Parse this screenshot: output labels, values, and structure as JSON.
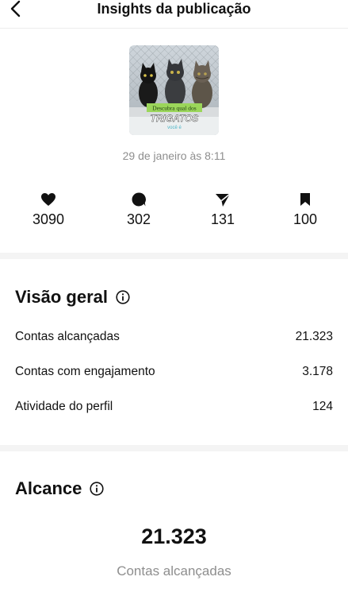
{
  "header": {
    "title": "Insights da publicação",
    "back_icon": "chevron-left-icon"
  },
  "post": {
    "thumbnail_text_top": "Descubra qual dos",
    "thumbnail_text_main": "TRIGATOS",
    "thumbnail_text_bottom": "você é",
    "date": "29 de janeiro às 8:11"
  },
  "stats": [
    {
      "icon": "heart-icon",
      "value": "3090"
    },
    {
      "icon": "comment-icon",
      "value": "302"
    },
    {
      "icon": "send-icon",
      "value": "131"
    },
    {
      "icon": "bookmark-icon",
      "value": "100"
    }
  ],
  "overview": {
    "title": "Visão geral",
    "info_icon": "info-icon",
    "rows": [
      {
        "label": "Contas alcançadas",
        "value": "21.323"
      },
      {
        "label": "Contas com engajamento",
        "value": "3.178"
      },
      {
        "label": "Atividade do perfil",
        "value": "124"
      }
    ]
  },
  "reach": {
    "title": "Alcance",
    "info_icon": "info-icon",
    "value": "21.323",
    "label": "Contas alcançadas"
  },
  "colors": {
    "text": "#111111",
    "muted": "#8e8e8e",
    "separator": "#f4f4f4",
    "thumb_banner": "#9bd65a"
  }
}
